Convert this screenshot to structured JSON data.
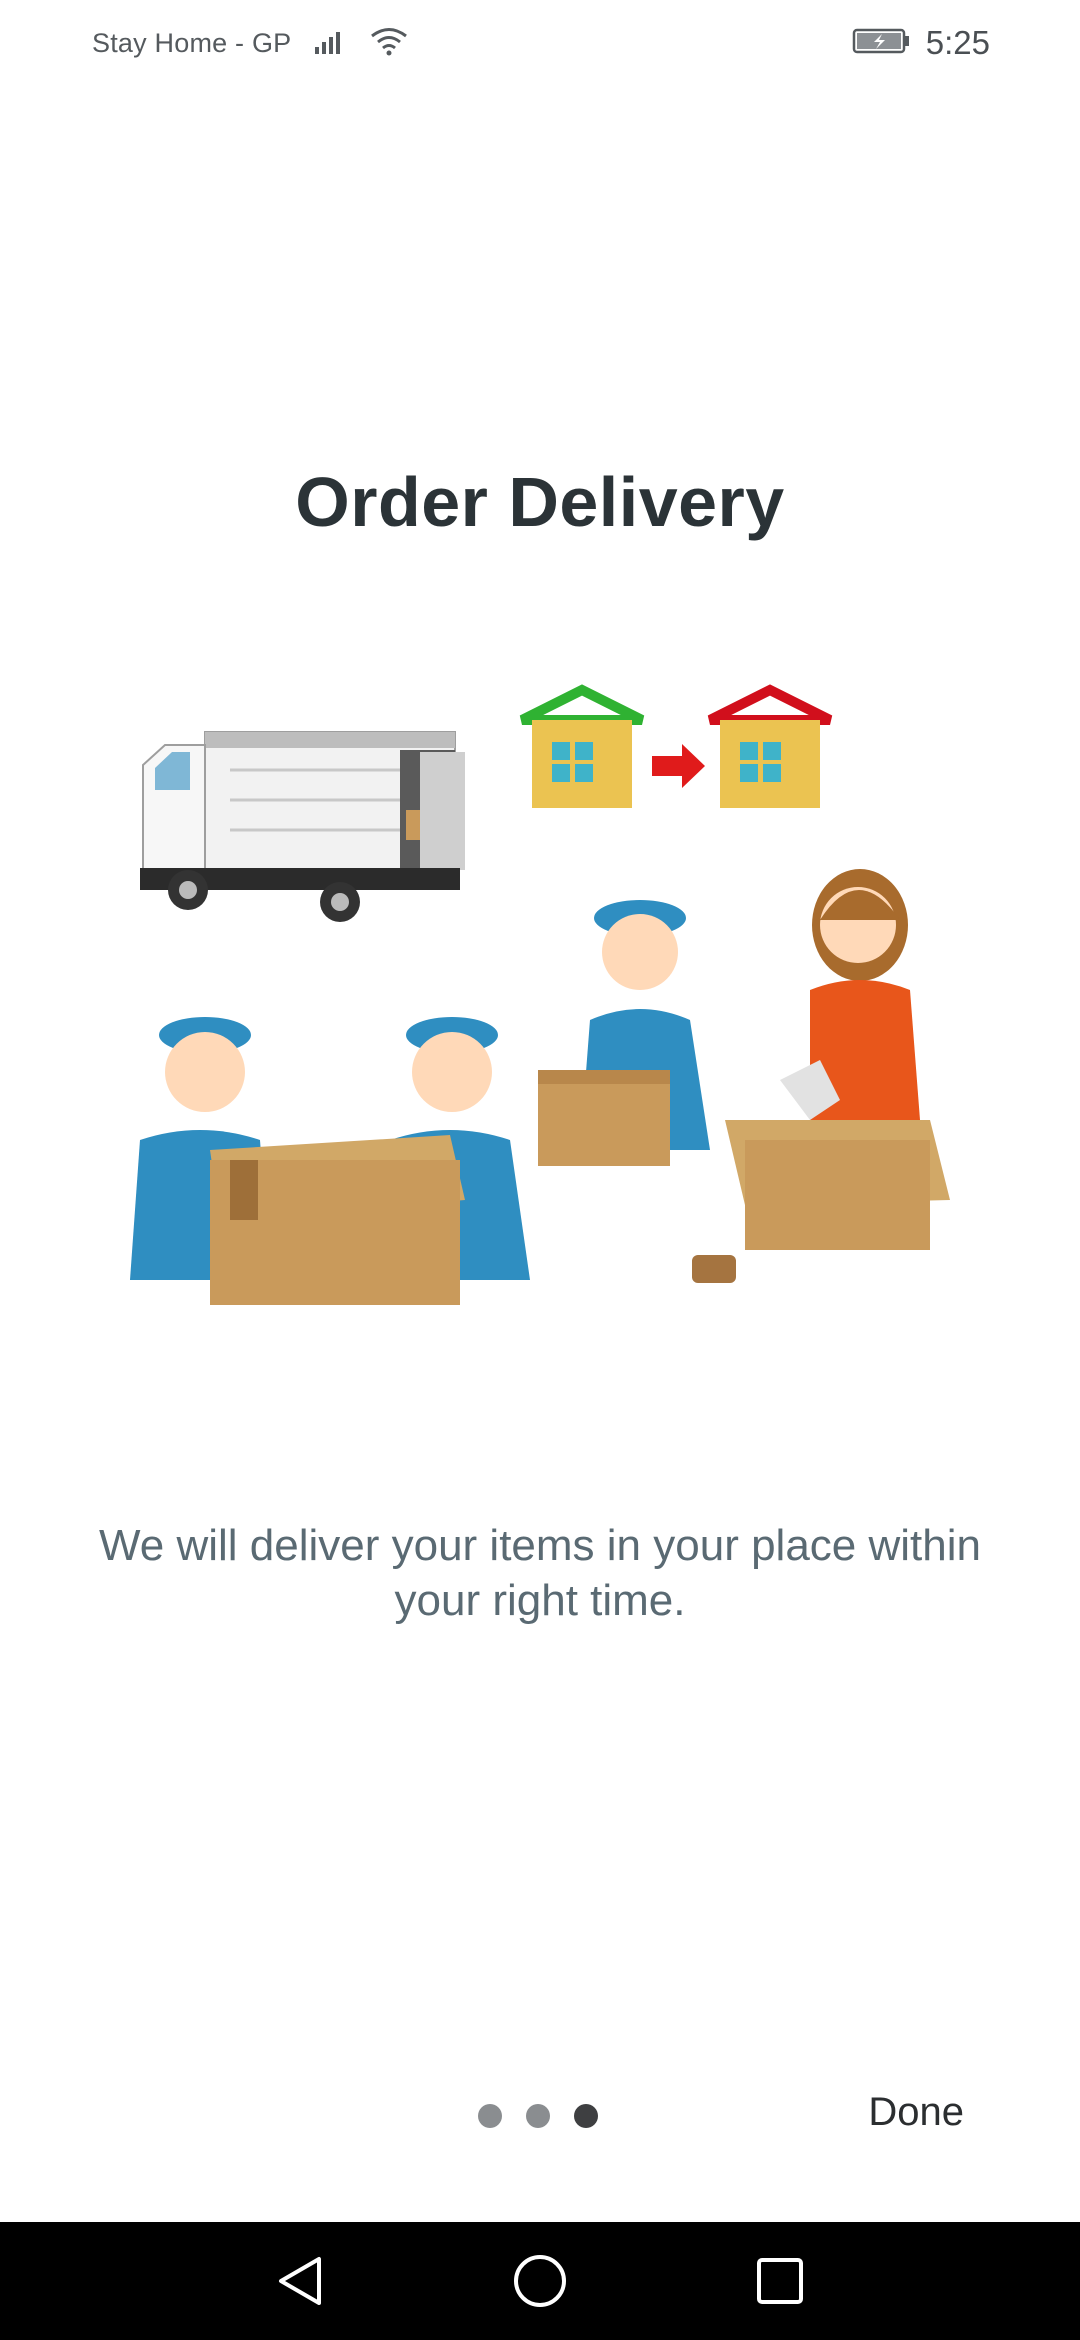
{
  "status_bar": {
    "carrier": "Stay Home - GP",
    "time": "5:25",
    "icons": [
      "signal-icon",
      "wifi-icon",
      "battery-charging-icon"
    ]
  },
  "onboarding": {
    "title": "Order Delivery",
    "description": "We will deliver your items in your place within your right time.",
    "illustration": "delivery-movers-illustration",
    "page_count": 3,
    "current_page": 3,
    "done_label": "Done"
  },
  "nav_bar": {
    "icons": [
      "back-icon",
      "home-icon",
      "recents-icon"
    ]
  },
  "colors": {
    "title": "#2b3337",
    "description": "#5a6a73",
    "dot_inactive": "#8a8d90",
    "dot_active": "#3e3f41",
    "nav_background": "#000000"
  }
}
